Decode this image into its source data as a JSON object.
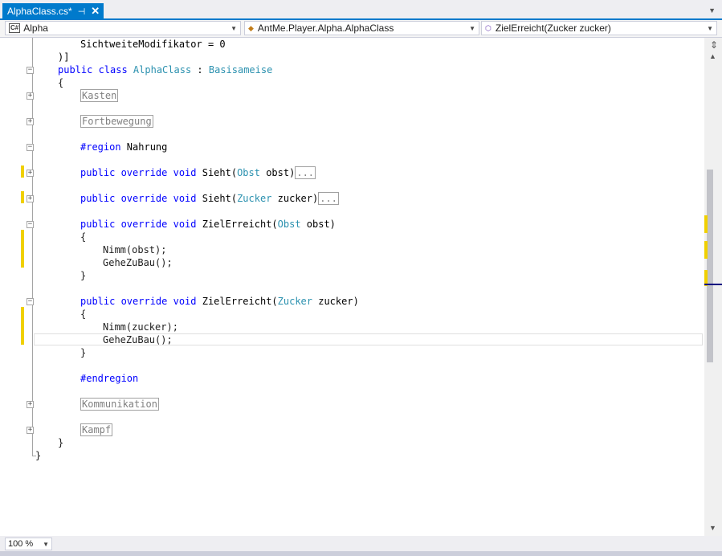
{
  "tab": {
    "title": "AlphaClass.cs*",
    "pin": "⊣",
    "close": "✕"
  },
  "navbar": {
    "project": {
      "icon": "C#",
      "label": "Alpha"
    },
    "type": {
      "icon": "class-icon",
      "label": "AntMe.Player.Alpha.AlphaClass"
    },
    "member": {
      "icon": "method-icon",
      "label": "ZielErreicht(Zucker zucker)"
    }
  },
  "code": {
    "l1": {
      "a": "SichtweiteModifikator = 0"
    },
    "l2": {
      "a": ")]"
    },
    "l3": {
      "kw1": "public class ",
      "ty1": "AlphaClass",
      "mid": " : ",
      "ty2": "Basisameise"
    },
    "l4": {
      "a": "{"
    },
    "l5": {
      "collapsed": "Kasten"
    },
    "l7": {
      "collapsed": "Fortbewegung"
    },
    "l9": {
      "kw": "#region",
      "rest": " Nahrung"
    },
    "l11": {
      "kw": "public override void ",
      "name": "Sieht(",
      "ty": "Obst",
      "rest": " obst)",
      "collapsed": "..."
    },
    "l13": {
      "kw": "public override void ",
      "name": "Sieht(",
      "ty": "Zucker",
      "rest": " zucker)",
      "collapsed": "..."
    },
    "l15": {
      "kw": "public override void ",
      "name": "ZielErreicht(",
      "ty": "Obst",
      "rest": " obst)"
    },
    "l16": {
      "a": "{"
    },
    "l17": {
      "a": "Nimm(obst);"
    },
    "l18": {
      "a": "GeheZuBau();"
    },
    "l19": {
      "a": "}"
    },
    "l21": {
      "kw": "public override void ",
      "name": "ZielErreicht(",
      "ty": "Zucker",
      "rest": " zucker)"
    },
    "l22": {
      "a": "{"
    },
    "l23": {
      "a": "Nimm(zucker);"
    },
    "l24": {
      "a": "GeheZuBau();"
    },
    "l25": {
      "a": "}"
    },
    "l27": {
      "kw": "#endregion"
    },
    "l29": {
      "collapsed": "Kommunikation"
    },
    "l31": {
      "collapsed": "Kampf"
    },
    "l32": {
      "a": "}"
    },
    "l33": {
      "a": "}"
    }
  },
  "statusbar": {
    "zoom": "100 %"
  },
  "colors": {
    "accent": "#007acc",
    "keyword": "#0000ff",
    "type": "#2b91af",
    "change_marker": "#f0d000"
  }
}
